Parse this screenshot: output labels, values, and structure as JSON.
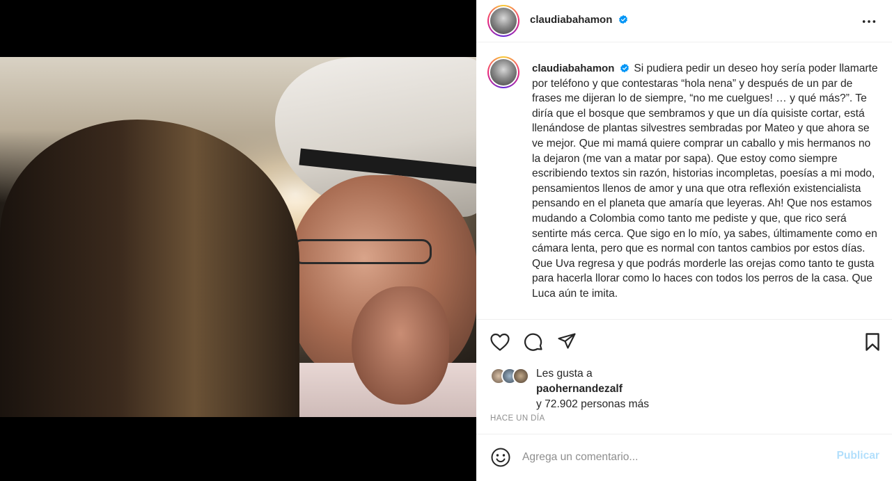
{
  "post": {
    "username": "claudiabahamon",
    "verified": true,
    "caption": "Si pudiera pedir un deseo hoy sería poder llamarte por teléfono y que contestaras “hola nena” y después de un par de frases me dijeran lo de siempre, “no me cuelgues! … y qué más?”. Te diría que el bosque que sembramos y que un día quisiste cortar, está llenándose de plantas silvestres sembradas por Mateo y que ahora se ve mejor. Que mi mamá quiere comprar un caballo y mis hermanos no la dejaron (me van a matar por sapa). Que estoy como siempre escribiendo textos sin razón, historias incompletas, poesías a mi modo, pensamientos llenos de amor y una que otra reflexión existencialista pensando en el planeta que amaría que leyeras. Ah! Que nos estamos mudando a Colombia como tanto me pediste y que, que rico será sentirte más cerca. Que sigo en lo mío, ya sabes, últimamente como en cámara lenta, pero que es normal con tantos cambios por estos días. Que Uva regresa y que podrás morderle las orejas como tanto te gusta para hacerla llorar como lo haces con todos los perros de la casa. Que Luca aún te imita.",
    "likes": {
      "prefix": "Les gusta a",
      "user": "paohernandezalf",
      "others": "y 72.902 personas más"
    },
    "time": "HACE UN DÍA"
  },
  "comment": {
    "placeholder": "Agrega un comentario...",
    "post_label": "Publicar"
  },
  "icons": {
    "more": "more-options-icon",
    "like": "heart-icon",
    "comment": "comment-icon",
    "share": "share-icon",
    "save": "bookmark-icon",
    "emoji": "emoji-icon",
    "verified": "verified-badge-icon"
  },
  "colors": {
    "verified": "#0095f6",
    "publish_disabled": "#b2dffc",
    "muted": "#8e8e8e"
  }
}
